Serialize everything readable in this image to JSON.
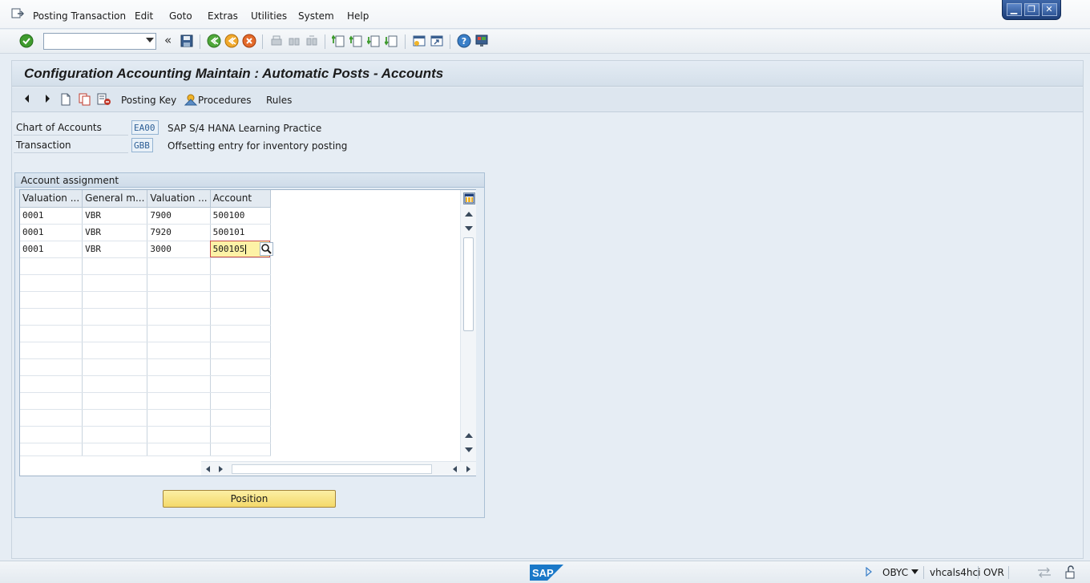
{
  "menu": {
    "items": [
      "Posting Transaction",
      "Edit",
      "Goto",
      "Extras",
      "Utilities",
      "System",
      "Help"
    ]
  },
  "window_controls": {
    "minimize": "▁",
    "restore": "❐",
    "close": "✕"
  },
  "toolbar": {
    "command_field_value": "",
    "nav_back": "«"
  },
  "title": "Configuration Accounting Maintain : Automatic Posts - Accounts",
  "app_toolbar": {
    "posting_key_label": "Posting Key",
    "procedures_label": "Procedures",
    "rules_label": "Rules"
  },
  "header": {
    "chart_label": "Chart of Accounts",
    "chart_value": "EA00",
    "chart_desc": "SAP S/4 HANA Learning Practice",
    "transaction_label": "Transaction",
    "transaction_value": "GBB",
    "transaction_desc": "Offsetting entry for inventory posting"
  },
  "assignment": {
    "group_title": "Account assignment",
    "columns": [
      "Valuation ...",
      "General m...",
      "Valuation ...",
      "Account"
    ],
    "rows": [
      [
        "0001",
        "VBR",
        "7900",
        "500100"
      ],
      [
        "0001",
        "VBR",
        "7920",
        "500101"
      ],
      [
        "0001",
        "VBR",
        "3000",
        "500105"
      ]
    ],
    "position_button": "Position"
  },
  "status": {
    "transaction_code": "OBYC",
    "server": "vhcals4hci",
    "mode": "OVR",
    "sap_logo": "SAP"
  },
  "colors": {
    "active_cell": "#fdf2a6",
    "accent_blue": "#1e3f7a",
    "sap_blue": "#1a78c8"
  }
}
